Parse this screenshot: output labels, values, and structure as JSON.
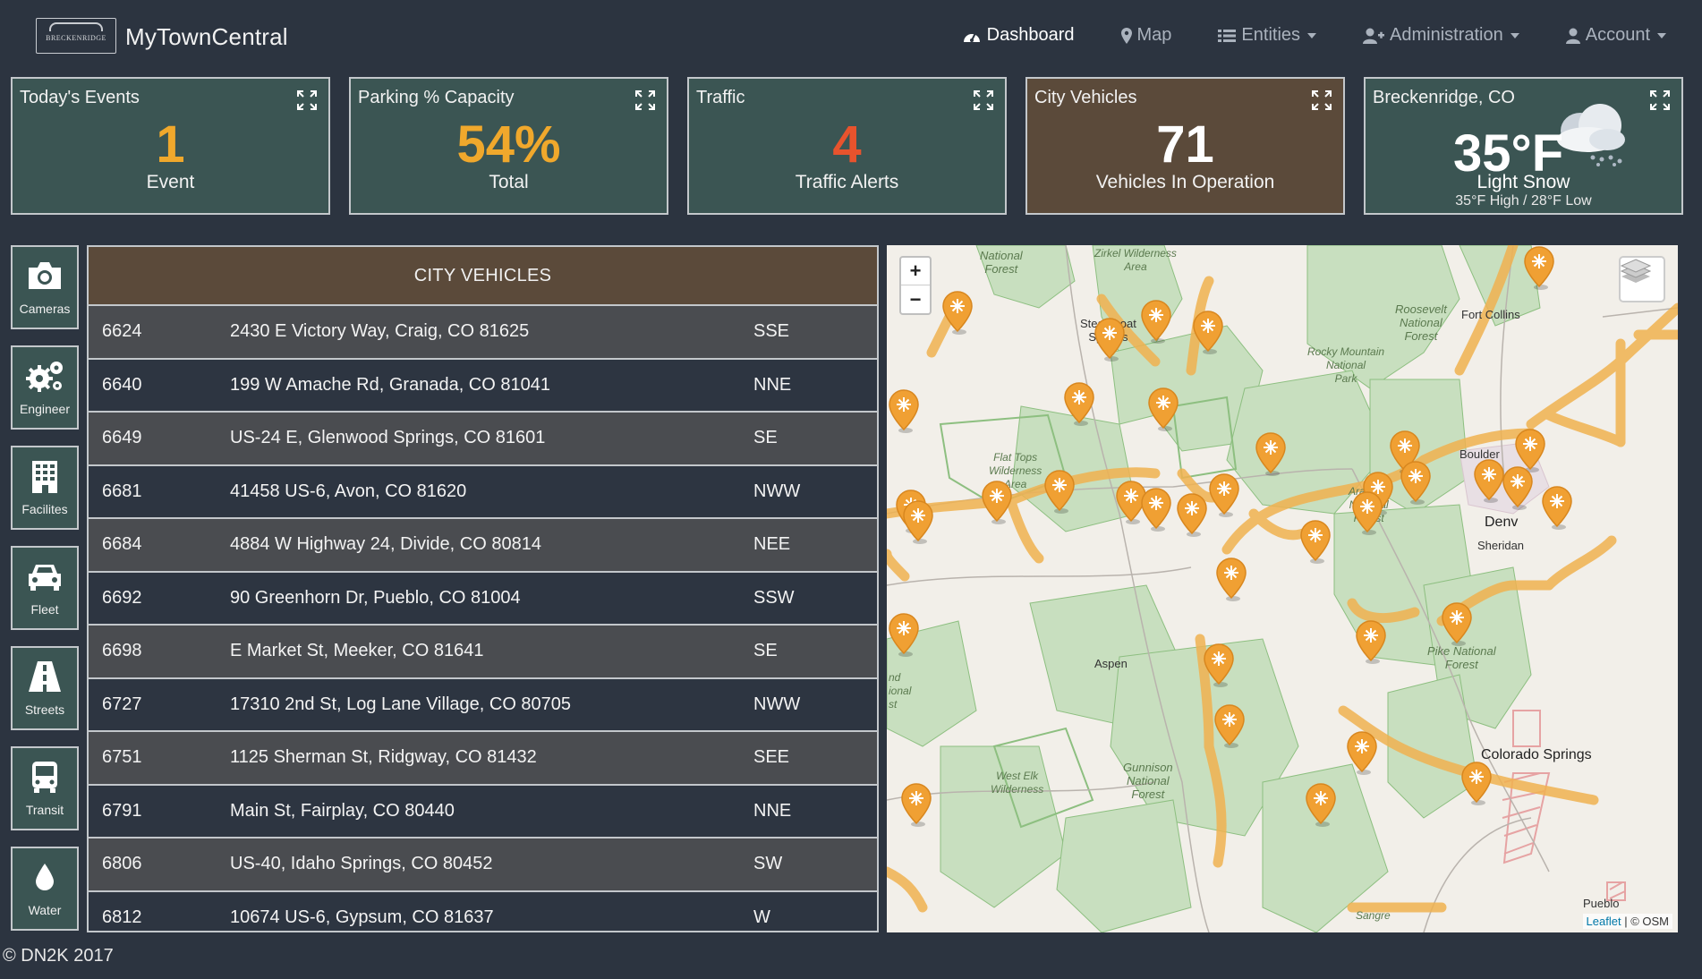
{
  "header": {
    "logo_text": "BRECKENRIDGE",
    "brand": "MyTownCentral",
    "nav": [
      {
        "label": "Dashboard",
        "icon": "dashboard-icon",
        "dropdown": false
      },
      {
        "label": "Map",
        "icon": "map-marker-icon",
        "dropdown": false
      },
      {
        "label": "Entities",
        "icon": "list-icon",
        "dropdown": true
      },
      {
        "label": "Administration",
        "icon": "user-plus-icon",
        "dropdown": true
      },
      {
        "label": "Account",
        "icon": "user-icon",
        "dropdown": true
      }
    ]
  },
  "cards": {
    "events": {
      "title": "Today's Events",
      "value": "1",
      "sub": "Event"
    },
    "parking": {
      "title": "Parking % Capacity",
      "value": "54%",
      "sub": "Total"
    },
    "traffic": {
      "title": "Traffic",
      "value": "4",
      "sub": "Traffic Alerts"
    },
    "vehicles": {
      "title": "City Vehicles",
      "value": "71",
      "sub": "Vehicles In Operation"
    },
    "weather": {
      "title": "Breckenridge, CO",
      "temp": "35°F",
      "condition": "Light Snow",
      "high_low": "35°F High / 28°F Low"
    }
  },
  "sidebar": [
    {
      "label": "Cameras",
      "icon": "camera-icon"
    },
    {
      "label": "Engineer",
      "icon": "gears-icon"
    },
    {
      "label": "Facilites",
      "icon": "building-icon"
    },
    {
      "label": "Fleet",
      "icon": "car-icon"
    },
    {
      "label": "Streets",
      "icon": "road-icon"
    },
    {
      "label": "Transit",
      "icon": "bus-icon"
    },
    {
      "label": "Water",
      "icon": "water-drop-icon"
    }
  ],
  "vehicle_table": {
    "title": "CITY VEHICLES",
    "rows": [
      {
        "id": "6624",
        "address": "2430 E Victory Way, Craig, CO 81625",
        "direction": "SSE"
      },
      {
        "id": "6640",
        "address": "199 W Amache Rd, Granada, CO 81041",
        "direction": "NNE"
      },
      {
        "id": "6649",
        "address": "US-24 E, Glenwood Springs, CO 81601",
        "direction": "SE"
      },
      {
        "id": "6681",
        "address": "41458 US-6, Avon, CO 81620",
        "direction": "NWW"
      },
      {
        "id": "6684",
        "address": "4884 W Highway 24, Divide, CO 80814",
        "direction": "NEE"
      },
      {
        "id": "6692",
        "address": "90 Greenhorn Dr, Pueblo, CO 81004",
        "direction": "SSW"
      },
      {
        "id": "6698",
        "address": "E Market St, Meeker, CO 81641",
        "direction": "SE"
      },
      {
        "id": "6727",
        "address": "17310 2nd St, Log Lane Village, CO 80705",
        "direction": "NWW"
      },
      {
        "id": "6751",
        "address": "1125 Sherman St, Ridgway, CO 81432",
        "direction": "SEE"
      },
      {
        "id": "6791",
        "address": "Main St, Fairplay, CO 80440",
        "direction": "NNE"
      },
      {
        "id": "6806",
        "address": "US-40, Idaho Springs, CO 80452",
        "direction": "SW"
      },
      {
        "id": "6812",
        "address": "10674 US-6, Gypsum, CO 81637",
        "direction": "W"
      }
    ]
  },
  "map": {
    "zoom_in": "+",
    "zoom_out": "−",
    "attribution_link": "Leaflet",
    "attribution_text": "| © OSM",
    "labels": {
      "routt": "National\nForest",
      "zirkel": "Zirkel Wilderness\nArea",
      "steamboat": "Steamboat\nSprings",
      "roosevelt": "Roosevelt\nNational\nForest",
      "fortcollins": "Fort Collins",
      "rmnp": "Rocky Mountain\nNational\nPark",
      "flattops": "Flat Tops\nWilderness\nArea",
      "boulder": "Boulder",
      "arapaho": "Arapaho\nNational\nForest",
      "denver": "Denv",
      "sheridan": "Sheridan",
      "aspen": "Aspen",
      "pike": "Pike National\nForest",
      "coloradosprings": "Colorado Springs",
      "westelk": "West Elk\nWilderness",
      "gunnison": "Gunnison\nNational\nForest",
      "sangre": "Sangre",
      "pueblo": "Pueblo",
      "leftforest": "nd\nional\nst"
    }
  },
  "footer": "© DN2K 2017"
}
